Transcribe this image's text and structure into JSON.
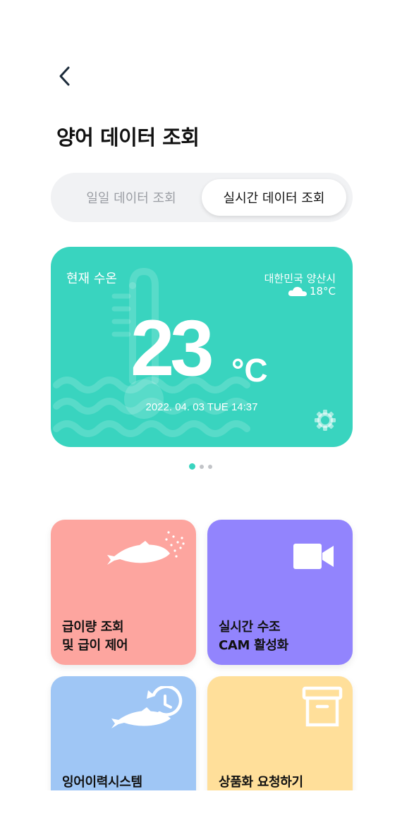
{
  "header": {
    "title": "양어 데이터 조회"
  },
  "segment": {
    "tab_daily": "일일 데이터 조회",
    "tab_realtime": "실시간 데이터 조회",
    "selected": "realtime"
  },
  "temperature_card": {
    "label": "현재 수온",
    "location": "대한민국 양산시",
    "weather_temp": "18°C",
    "weather_icon": "cloud-icon",
    "value": "23",
    "unit": "°C",
    "datetime": "2022. 04. 03 TUE 14:37",
    "bg_color": "#39d4bf"
  },
  "pager": {
    "count": 3,
    "active_index": 0
  },
  "tiles": {
    "feed": {
      "line1": "급이량 조회",
      "line2": "및 급이 제어",
      "color": "#fda59f",
      "icon": "fish-feed-icon"
    },
    "cam": {
      "line1": "실시간 수조",
      "line2": "CAM 활성화",
      "color": "#9284fd",
      "icon": "video-camera-icon"
    },
    "history": {
      "line1": "잉어이력시스템",
      "color": "#9fc6f5",
      "icon": "fish-history-icon"
    },
    "product": {
      "line1": "상품화 요청하기",
      "color": "#ffdf9a",
      "icon": "archive-box-icon"
    }
  }
}
